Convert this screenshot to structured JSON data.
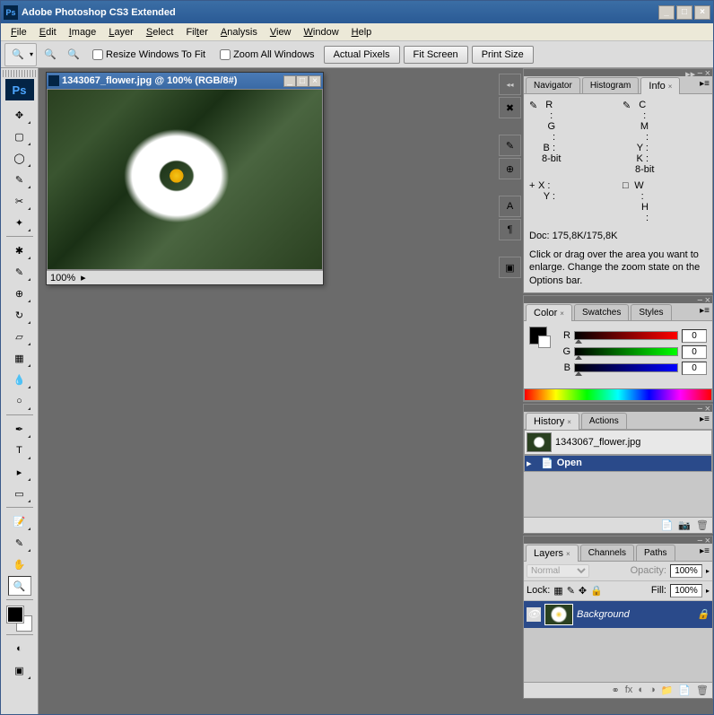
{
  "window": {
    "title": "Adobe Photoshop CS3 Extended",
    "logo_text": "Ps"
  },
  "menu": {
    "file": "File",
    "edit": "Edit",
    "image": "Image",
    "layer": "Layer",
    "select": "Select",
    "filter": "Filter",
    "analysis": "Analysis",
    "view": "View",
    "window": "Window",
    "help": "Help"
  },
  "options": {
    "resize_windows": "Resize Windows To Fit",
    "zoom_all": "Zoom All Windows",
    "actual_pixels": "Actual Pixels",
    "fit_screen": "Fit Screen",
    "print_size": "Print Size"
  },
  "document": {
    "title": "1343067_flower.jpg @ 100% (RGB/8#)",
    "zoom": "100%"
  },
  "info_panel": {
    "tabs": [
      "Navigator",
      "Histogram",
      "Info"
    ],
    "r": "R :",
    "g": "G :",
    "b": "B :",
    "bit1": "8-bit",
    "c": "C :",
    "m": "M :",
    "y": "Y :",
    "k": "K :",
    "bit2": "8-bit",
    "x": "X :",
    "yc": "Y :",
    "w": "W :",
    "h": "H :",
    "doc": "Doc: 175,8K/175,8K",
    "hint": "Click or drag over the area you want to enlarge. Change the zoom state on the Options bar."
  },
  "color_panel": {
    "tabs": [
      "Color",
      "Swatches",
      "Styles"
    ],
    "r": "R",
    "g": "G",
    "b": "B",
    "rv": "0",
    "gv": "0",
    "bv": "0"
  },
  "history_panel": {
    "tabs": [
      "History",
      "Actions"
    ],
    "filename": "1343067_flower.jpg",
    "state": "Open"
  },
  "layers_panel": {
    "tabs": [
      "Layers",
      "Channels",
      "Paths"
    ],
    "mode": "Normal",
    "opacity_label": "Opacity:",
    "opacity": "100%",
    "lock_label": "Lock:",
    "fill_label": "Fill:",
    "fill": "100%",
    "layer_name": "Background"
  }
}
